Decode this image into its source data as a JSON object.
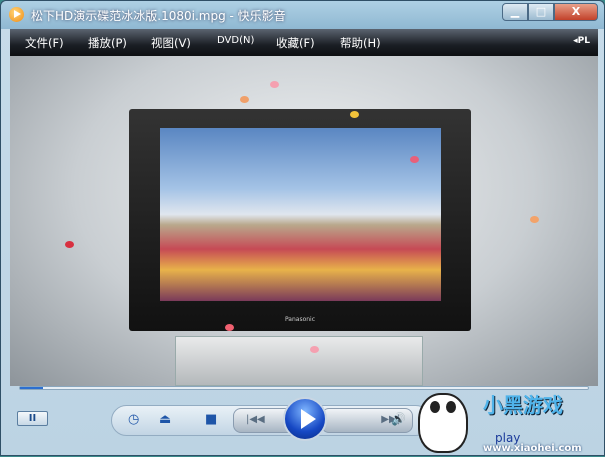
{
  "window": {
    "title": "松下HD演示碟范冰冰版.1080i.mpg - 快乐影音",
    "min": "▁",
    "max": "□",
    "close": "X"
  },
  "menu": [
    {
      "label": "文件(F)"
    },
    {
      "label": "播放(P)"
    },
    {
      "label": "视图(V)"
    },
    {
      "label": "DVD(N)"
    },
    {
      "label": "收藏(F)"
    },
    {
      "label": "帮助(H)"
    }
  ],
  "playlist_toggle": "◂PL",
  "video": {
    "tv_brand": "Panasonic"
  },
  "playback": {
    "progress_percent": 4,
    "state": "paused"
  },
  "controls": {
    "pause": "II",
    "clock": "◷",
    "eject": "⏏",
    "stop": "■",
    "prev": "|◀◀",
    "next": "▶▶|",
    "volume": "🔊"
  },
  "watermark": {
    "logo": "小黑游戏",
    "sub": "游戏",
    "text1": "play",
    "url": "www.xiaohei.com"
  }
}
